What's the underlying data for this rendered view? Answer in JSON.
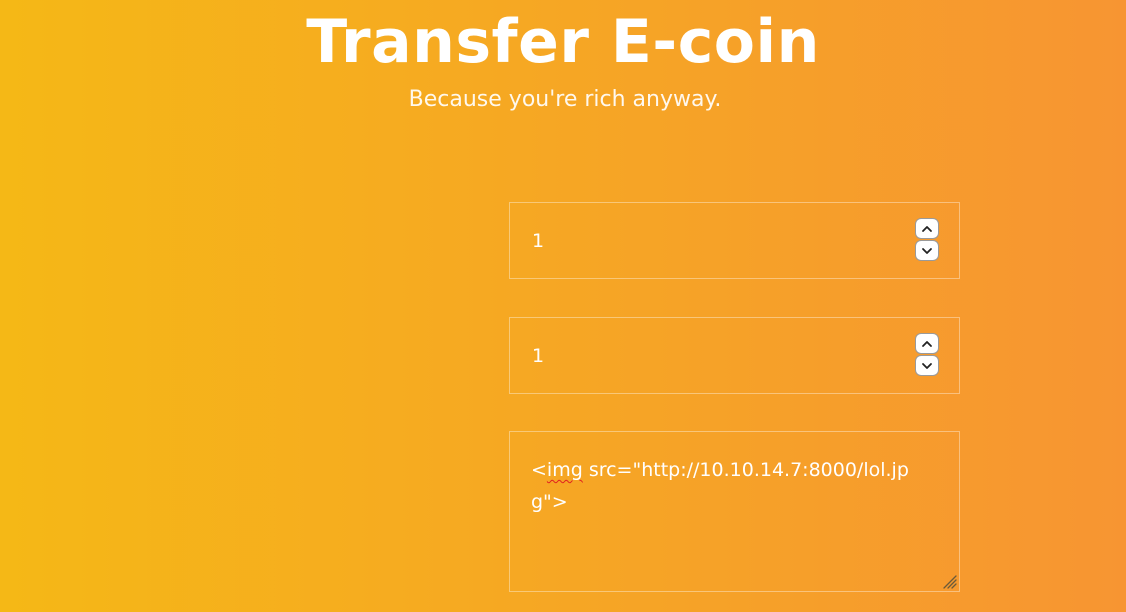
{
  "colors": {
    "gradient_start": "#f5b816",
    "gradient_end": "#f79532",
    "text": "#ffffff",
    "spellcheck_underline": "#e02020"
  },
  "header": {
    "title": "Transfer E-coin",
    "subtitle": "Because you're rich anyway."
  },
  "form": {
    "amount_field": {
      "value": "1"
    },
    "recipient_field": {
      "value": "1"
    },
    "message_field": {
      "value_part1": "<",
      "value_misspelled": "img",
      "value_part2": " src=\"http://10.10.14.7:8000/lol.jpg\">"
    }
  },
  "icons": {
    "stepper_up": "chevron-up-icon",
    "stepper_down": "chevron-down-icon",
    "resize": "resize-grip-icon"
  }
}
